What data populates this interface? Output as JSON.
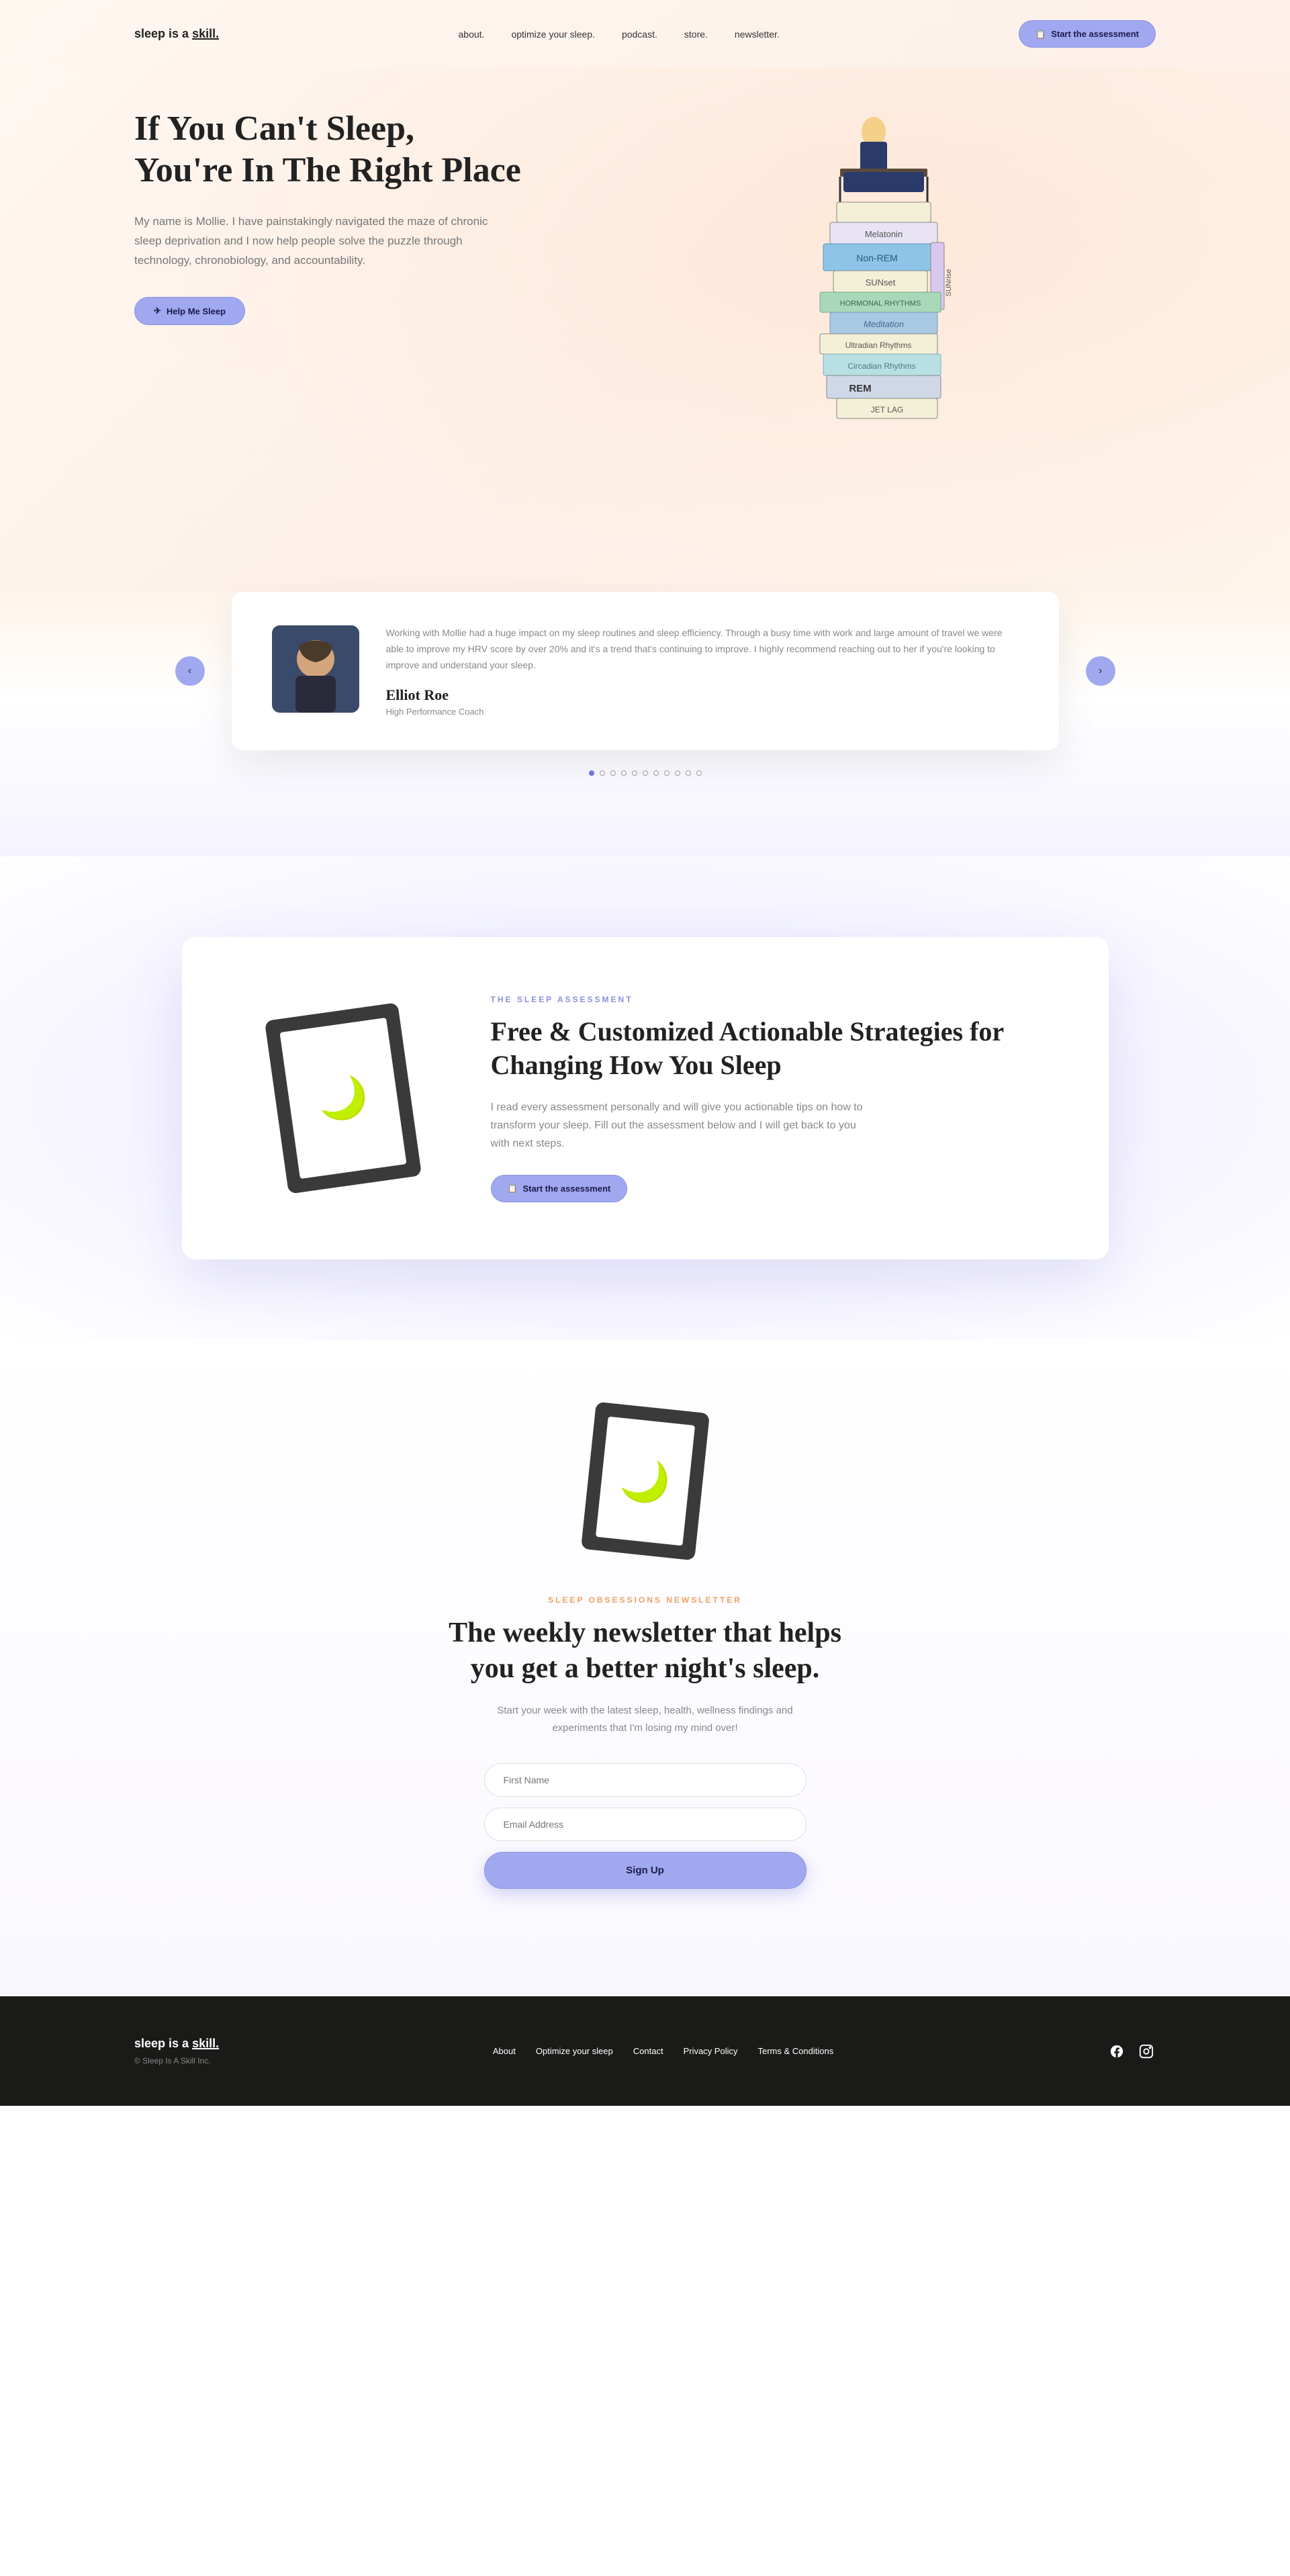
{
  "brand": {
    "prefix": "sleep is a ",
    "highlight": "skill."
  },
  "nav": {
    "about": "about.",
    "optimize": "optimize your sleep.",
    "podcast": "podcast.",
    "store": "store.",
    "newsletter": "newsletter."
  },
  "header_cta": "Start the assessment",
  "hero": {
    "title_line1": "If You Can't Sleep,",
    "title_line2": "You're In The Right Place",
    "description": "My name is Mollie. I have painstakingly navigated the maze of chronic sleep deprivation and I now help people solve the puzzle through technology, chronobiology, and accountability.",
    "cta": "Help Me Sleep"
  },
  "testimonial": {
    "quote": "Working with Mollie had a huge impact on my sleep routines and sleep efficiency. Through a busy time with work and large amount of travel we were able to improve my HRV score by over 20% and it's a trend that's continuing to improve. I highly recommend reaching out to her if you're looking to improve and understand your sleep.",
    "name": "Elliot Roe",
    "role": "High Performance Coach",
    "dots_count": 11,
    "active_dot": 0
  },
  "assessment": {
    "eyebrow": "THE SLEEP ASSESSMENT",
    "title": "Free & Customized Actionable Strategies for Changing How You Sleep",
    "description": "I read every assessment personally and will give you actionable tips on how to transform your sleep. Fill out the assessment below and I will get back to you with next steps.",
    "cta": "Start the assessment"
  },
  "newsletter": {
    "eyebrow": "SLEEP OBSESSIONS NEWSLETTER",
    "title": "The weekly newsletter that helps you get a better night's sleep.",
    "description": "Start your week with the latest sleep, health, wellness findings and experiments that I'm losing my mind over!",
    "placeholder_name": "First Name",
    "placeholder_email": "Email Address",
    "submit": "Sign Up"
  },
  "footer": {
    "copyright": "© Sleep Is A Skill Inc.",
    "links": {
      "about": "About",
      "optimize": "Optimize your sleep",
      "contact": "Contact",
      "privacy": "Privacy Policy",
      "terms": "Terms & Conditions"
    }
  },
  "book_labels": [
    "Melatonin",
    "Non-REM",
    "SUNset",
    "SUNrise",
    "HORMONAL RHYTHMS",
    "Meditation",
    "Ultradian Rhythms",
    "Circadian Rhythms",
    "REM",
    "JET LAG"
  ]
}
